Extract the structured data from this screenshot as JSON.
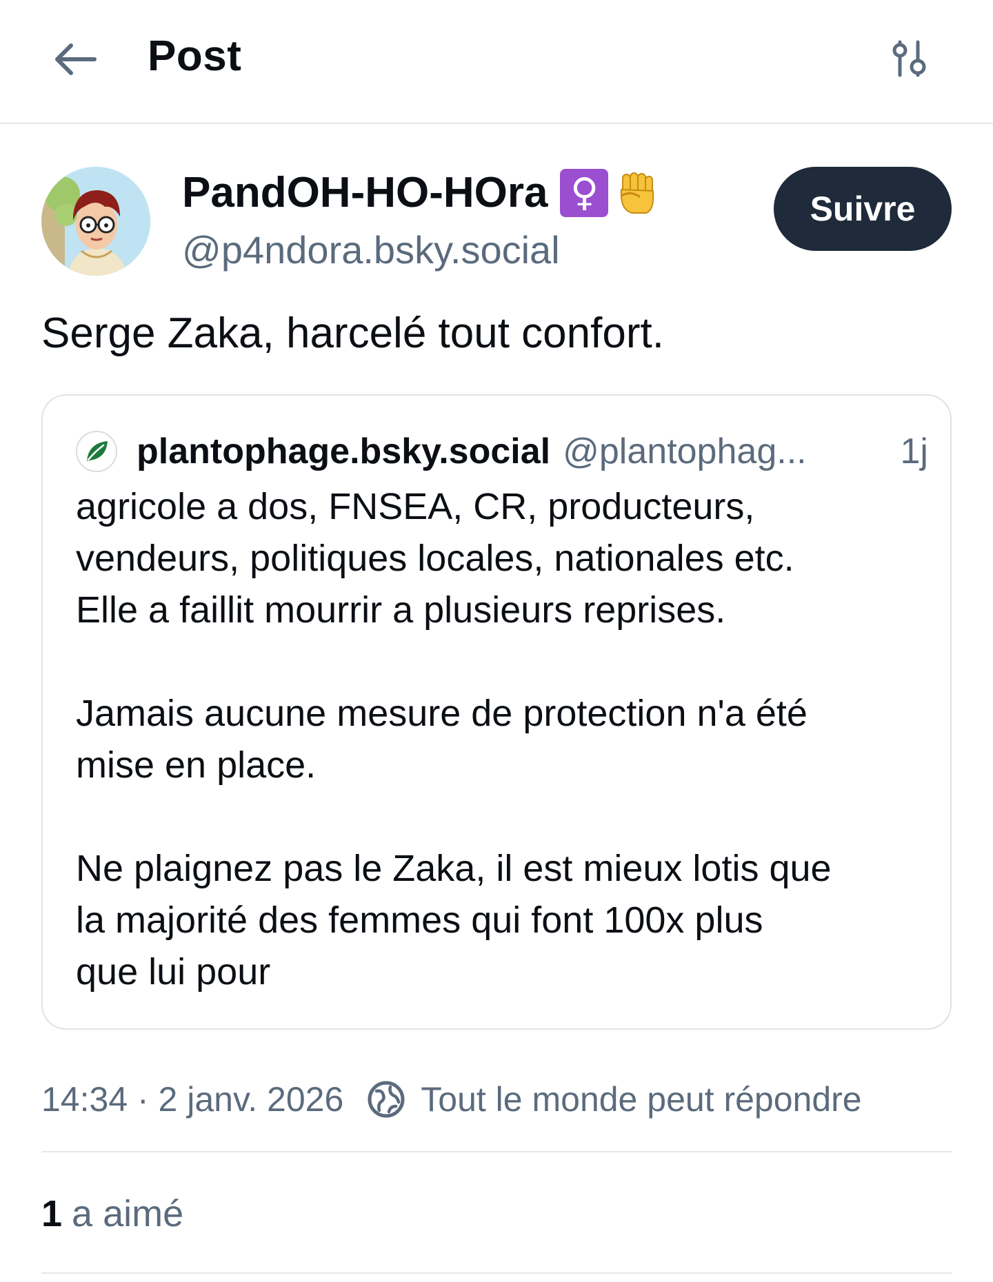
{
  "header": {
    "title": "Post",
    "back_icon": "arrow-left-icon",
    "options_icon": "sliders-icon"
  },
  "author": {
    "display_name": "PandOH-HO-HOra",
    "badges": [
      "♀",
      "✊"
    ],
    "handle": "@p4ndora.bsky.social",
    "follow_label": "Suivre"
  },
  "post": {
    "text": "Serge Zaka, harcelé tout confort."
  },
  "quote": {
    "author_name": "plantophage.bsky.social",
    "author_handle": "@plantophag...",
    "time": "1j",
    "lines": [
      "agricole a dos, FNSEA, CR, producteurs,",
      "vendeurs, politiques locales, nationales etc.",
      "Elle a faillit mourrir a plusieurs reprises.",
      "",
      "Jamais aucune mesure de protection n'a été",
      "mise en place.",
      "",
      "Ne plaignez pas le Zaka, il est mieux lotis que",
      "la majorité des femmes qui font 100x plus",
      "que lui pour"
    ]
  },
  "meta": {
    "timestamp": "14:34 · 2 janv. 2026",
    "reply_setting": "Tout le monde peut répondre"
  },
  "likes": {
    "count": "1",
    "label": "a aimé"
  },
  "colors": {
    "text_primary": "#0b0f14",
    "text_secondary": "#5b6b7d",
    "button_dark": "#1f2a3a",
    "divider": "#e3e6ea",
    "leaf_green": "#1e7a3c",
    "female_badge": "#9a4fd0"
  }
}
